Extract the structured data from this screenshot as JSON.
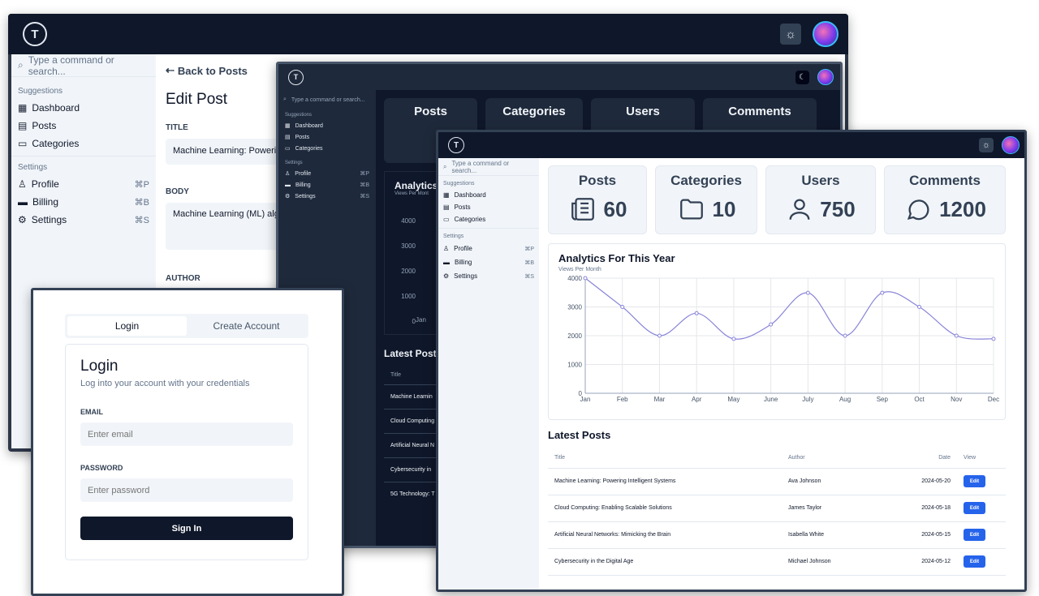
{
  "app": {
    "logo_letter": "T"
  },
  "sidebar": {
    "search_placeholder": "Type a command or search...",
    "groups": {
      "suggestions": "Suggestions",
      "settings": "Settings"
    },
    "items": {
      "dashboard": "Dashboard",
      "posts": "Posts",
      "categories": "Categories",
      "profile": "Profile",
      "billing": "Billing",
      "settings": "Settings"
    },
    "shortcuts": {
      "profile": "⌘P",
      "billing": "⌘B",
      "settings": "⌘S"
    }
  },
  "edit_post": {
    "back": "Back to Posts",
    "heading": "Edit Post",
    "title_label": "TITLE",
    "title_value": "Machine Learning: Powering Intelligent Systems",
    "body_label": "BODY",
    "body_value": "Machine Learning (ML) algorithms enable systems to learn from data",
    "author_label": "AUTHOR"
  },
  "stats": [
    {
      "label": "Posts",
      "value": "60",
      "icon": "newspaper-icon"
    },
    {
      "label": "Categories",
      "value": "10",
      "icon": "folder-icon"
    },
    {
      "label": "Users",
      "value": "750",
      "icon": "user-icon"
    },
    {
      "label": "Comments",
      "value": "1200",
      "icon": "message-icon"
    }
  ],
  "analytics": {
    "title": "Analytics For This Year",
    "subtitle": "Views Per Month"
  },
  "chart_data": {
    "type": "line",
    "categories": [
      "Jan",
      "Feb",
      "Mar",
      "Apr",
      "May",
      "June",
      "July",
      "Aug",
      "Sep",
      "Oct",
      "Nov",
      "Dec"
    ],
    "values": [
      4000,
      3000,
      2000,
      2780,
      1890,
      2390,
      3490,
      2000,
      3490,
      3000,
      2000,
      1890
    ],
    "yticks": [
      "0",
      "1000",
      "2000",
      "3000",
      "4000"
    ],
    "ylim": [
      0,
      4000
    ],
    "color": "#8884d8",
    "grid": true
  },
  "latest_posts": {
    "heading": "Latest Posts",
    "columns": {
      "title": "Title",
      "author": "Author",
      "date": "Date",
      "view": "View"
    },
    "edit_label": "Edit",
    "rows": [
      {
        "title": "Machine Learning: Powering Intelligent Systems",
        "author": "Ava Johnson",
        "date": "2024-05-20"
      },
      {
        "title": "Cloud Computing: Enabling Scalable Solutions",
        "author": "James Taylor",
        "date": "2024-05-18"
      },
      {
        "title": "Artificial Neural Networks: Mimicking the Brain",
        "author": "Isabella White",
        "date": "2024-05-15"
      },
      {
        "title": "Cybersecurity in the Digital Age",
        "author": "Michael Johnson",
        "date": "2024-05-12"
      }
    ],
    "mid_rows": [
      "Machine Learnin",
      "Cloud Computing",
      "Artificial Neural N",
      "Cybersecurity in",
      "5G Technology: T"
    ],
    "mid_jan": "Jan",
    "mid_heading": "Latest Post",
    "mid_analytics": "Analytics",
    "mid_sub": "Views Per Mont"
  },
  "login": {
    "tab_login": "Login",
    "tab_create": "Create Account",
    "heading": "Login",
    "subtitle": "Log into your account with your credentials",
    "email_label": "EMAIL",
    "email_placeholder": "Enter email",
    "password_label": "PASSWORD",
    "password_placeholder": "Enter password",
    "submit": "Sign In"
  },
  "colors": {
    "navy": "#0f172a",
    "accent": "#2563eb",
    "line": "#8884d8"
  }
}
